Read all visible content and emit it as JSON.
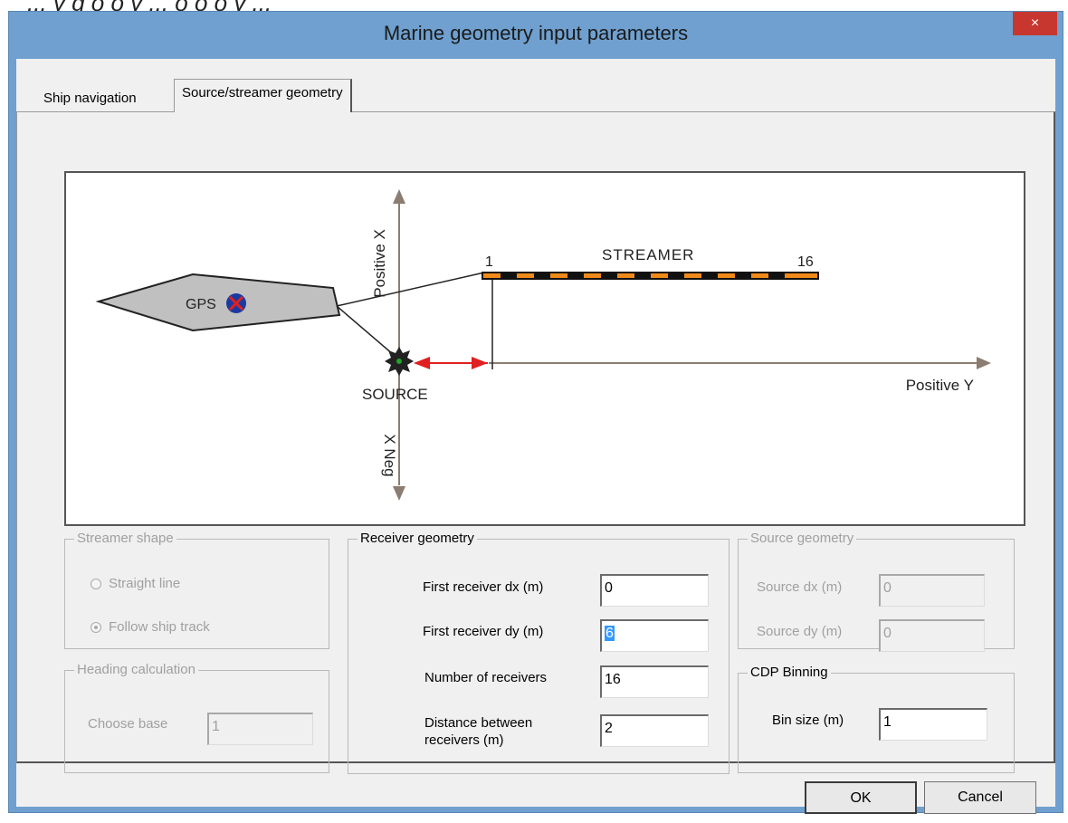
{
  "top_fragment": "... y g o o y ... o o o y ...",
  "window": {
    "title": "Marine geometry input parameters",
    "close_glyph": "×"
  },
  "tabs": [
    {
      "label": "Ship navigation",
      "active": false
    },
    {
      "label": "Source/streamer geometry",
      "active": true
    }
  ],
  "diagram": {
    "positive_x": "Positive X",
    "x_neg": "X Neg",
    "positive_y": "Positive Y",
    "gps": "GPS",
    "source": "SOURCE",
    "streamer": "STREAMER",
    "first_receiver": "1",
    "last_receiver": "16",
    "colors": {
      "ship": "#c0c0c0",
      "streamer_dash": "#f08a1a",
      "arrow": "#e02020",
      "axis": "#8b7d72",
      "gps_mark": "#1a3aa0",
      "gps_x": "#e02020",
      "source_dot": "#22a22a"
    }
  },
  "streamer_shape": {
    "legend": "Streamer shape",
    "options": [
      {
        "label": "Straight line",
        "selected": false
      },
      {
        "label": "Follow ship track",
        "selected": true
      }
    ]
  },
  "heading": {
    "legend": "Heading calculation",
    "choose_base_label": "Choose base",
    "choose_base_value": "1"
  },
  "receiver": {
    "legend": "Receiver geometry",
    "dx_label": "First receiver dx (m)",
    "dx_value": "0",
    "dy_label": "First receiver dy (m)",
    "dy_value": "6",
    "num_label": "Number of receivers",
    "num_value": "16",
    "dist_label_1": "Distance between",
    "dist_label_2": "receivers (m)",
    "dist_value": "2"
  },
  "source_geom": {
    "legend": "Source geometry",
    "dx_label": "Source dx (m)",
    "dx_value": "0",
    "dy_label": "Source dy (m)",
    "dy_value": "0"
  },
  "cdp": {
    "legend": "CDP Binning",
    "bin_label": "Bin size (m)",
    "bin_value": "1"
  },
  "buttons": {
    "ok": "OK",
    "cancel": "Cancel"
  }
}
